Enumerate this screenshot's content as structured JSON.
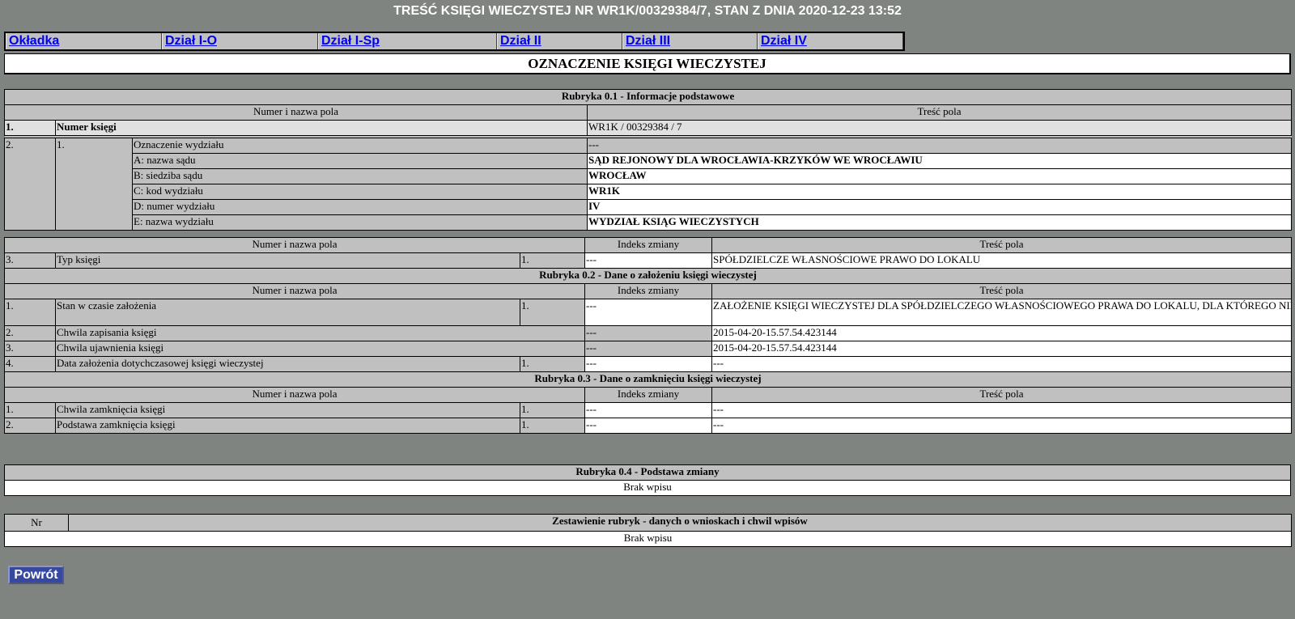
{
  "title": "TREŚĆ KSIĘGI WIECZYSTEJ NR WR1K/00329384/7, STAN Z DNIA 2020-12-23 13:52",
  "tabs": [
    "Okładka",
    "Dział I-O",
    "Dział I-Sp",
    "Dział II",
    "Dział III",
    "Dział IV"
  ],
  "section_title": "OZNACZENIE KSIĘGI WIECZYSTEJ",
  "rub01": {
    "title": "Rubryka 0.1 - Informacje podstawowe",
    "col_name": "Numer i nazwa pola",
    "col_content": "Treść pola",
    "r1_num": "1.",
    "r1_label": "Numer księgi",
    "r1_value": "WR1K / 00329384 / 7",
    "r2_num": "2.",
    "r2_sub": "1.",
    "r2_fields": [
      {
        "label": "Oznaczenie wydziału",
        "value": "---"
      },
      {
        "label": "A: nazwa sądu",
        "value": "SĄD REJONOWY DLA WROCŁAWIA-KRZYKÓW WE WROCŁAWIU"
      },
      {
        "label": "B: siedziba sądu",
        "value": "WROCŁAW"
      },
      {
        "label": "C: kod wydziału",
        "value": "WR1K"
      },
      {
        "label": "D: numer wydziału",
        "value": "IV"
      },
      {
        "label": "E: nazwa wydziału",
        "value": "WYDZIAŁ KSIĄG WIECZYSTYCH"
      }
    ],
    "col_index": "Indeks zmiany",
    "r3_num": "3.",
    "r3_label": "Typ księgi",
    "r3_idx": "1.",
    "r3_change": "---",
    "r3_value": "SPÓŁDZIELCZE WŁASNOŚCIOWE PRAWO DO LOKALU"
  },
  "rub02": {
    "title": "Rubryka 0.2 - Dane o założeniu księgi wieczystej",
    "col_name": "Numer i nazwa pola",
    "col_index": "Indeks zmiany",
    "col_content": "Treść pola",
    "rows": [
      {
        "num": "1.",
        "label": "Stan w czasie założenia",
        "idx": "1.",
        "change": "---",
        "value": "ZAŁOŻENIE KSIĘGI WIECZYSTEJ DLA SPÓŁDZIELCZEGO WŁASNOŚCIOWEGO PRAWA DO LOKALU, DLA KTÓREGO NIE BYŁA PROWADZONA KSIĘGA WIECZYSTA"
      },
      {
        "num": "2.",
        "label": "Chwila zapisania księgi",
        "idx": "",
        "change": "---",
        "value": "2015-04-20-15.57.54.423144"
      },
      {
        "num": "3.",
        "label": "Chwila ujawnienia księgi",
        "idx": "",
        "change": "---",
        "value": "2015-04-20-15.57.54.423144"
      },
      {
        "num": "4.",
        "label": "Data założenia dotychczasowej księgi wieczystej",
        "idx": "1.",
        "change": "---",
        "value": "---"
      }
    ]
  },
  "rub03": {
    "title": "Rubryka 0.3 - Dane o zamknięciu księgi wieczystej",
    "col_name": "Numer i nazwa pola",
    "col_index": "Indeks zmiany",
    "col_content": "Treść pola",
    "rows": [
      {
        "num": "1.",
        "label": "Chwila zamknięcia księgi",
        "idx": "1.",
        "change": "---",
        "value": "---"
      },
      {
        "num": "2.",
        "label": "Podstawa zamknięcia księgi",
        "idx": "1.",
        "change": "---",
        "value": "---"
      }
    ]
  },
  "rub04": {
    "title": "Rubryka 0.4 - Podstawa zmiany",
    "empty": "Brak wpisu"
  },
  "summary": {
    "col_nr": "Nr",
    "title": "Zestawienie rubryk - danych o wnioskach i chwil wpisów",
    "empty": "Brak wpisu"
  },
  "back_button": "Powrót"
}
